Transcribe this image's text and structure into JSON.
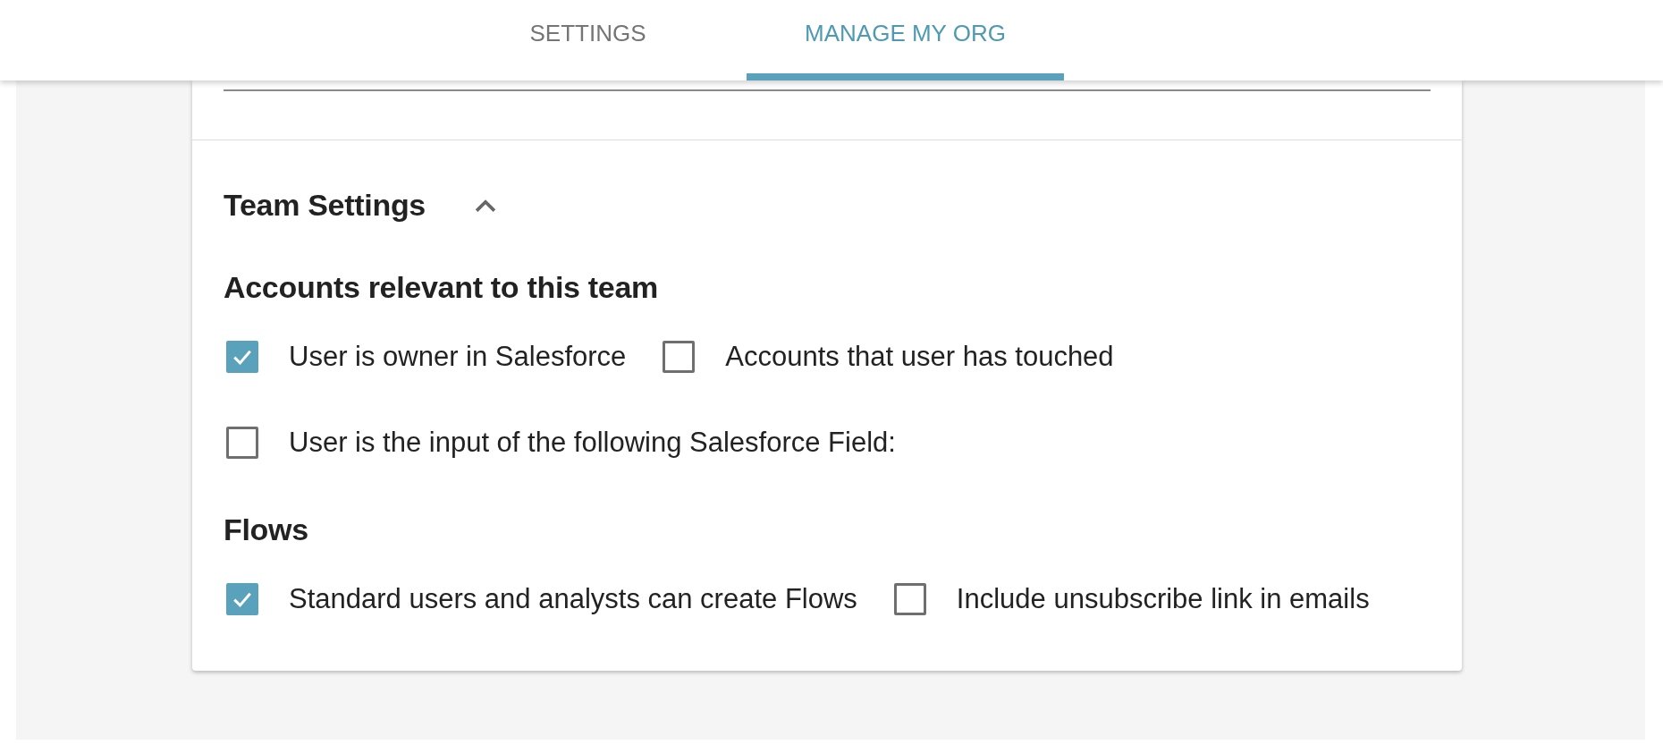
{
  "tabs": [
    {
      "label": "SETTINGS",
      "selected": false
    },
    {
      "label": "MANAGE MY ORG",
      "selected": true
    }
  ],
  "section": {
    "title": "Team Settings",
    "expanded": true,
    "groups": [
      {
        "title": "Accounts relevant to this team",
        "rows": [
          [
            {
              "label": "User is owner in Salesforce",
              "checked": true
            },
            {
              "label": "Accounts that user has touched",
              "checked": false
            }
          ],
          [
            {
              "label": "User is the input of the following Salesforce Field:",
              "checked": false
            }
          ]
        ]
      },
      {
        "title": "Flows",
        "rows": [
          [
            {
              "label": "Standard users and analysts can create Flows",
              "checked": true
            },
            {
              "label": "Include unsubscribe link in emails",
              "checked": false
            }
          ]
        ]
      }
    ]
  }
}
